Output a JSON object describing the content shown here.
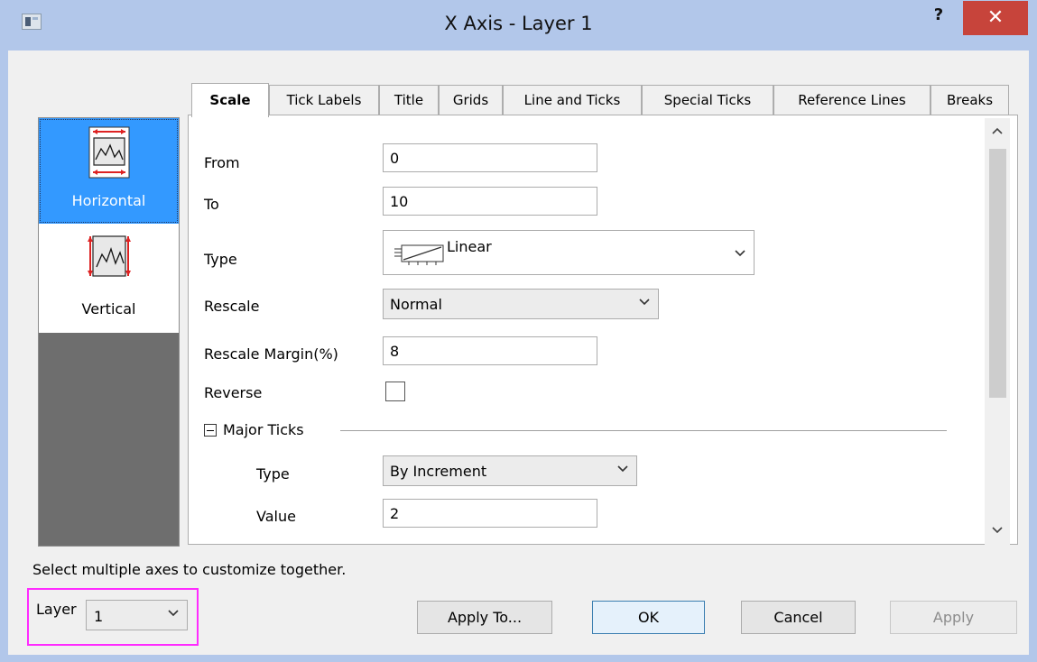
{
  "window": {
    "title": "X Axis - Layer 1",
    "help_label": "?",
    "close_label": "✕"
  },
  "sidebar": {
    "items": [
      {
        "label": "Horizontal",
        "selected": true
      },
      {
        "label": "Vertical",
        "selected": false
      }
    ]
  },
  "tabs": [
    {
      "label": "Scale",
      "active": true
    },
    {
      "label": "Tick Labels"
    },
    {
      "label": "Title"
    },
    {
      "label": "Grids"
    },
    {
      "label": "Line and Ticks"
    },
    {
      "label": "Special Ticks"
    },
    {
      "label": "Reference Lines"
    },
    {
      "label": "Breaks"
    }
  ],
  "scale": {
    "from_label": "From",
    "from_value": "0",
    "to_label": "To",
    "to_value": "10",
    "type_label": "Type",
    "type_value": "Linear",
    "rescale_label": "Rescale",
    "rescale_value": "Normal",
    "rescale_margin_label": "Rescale Margin(%)",
    "rescale_margin_value": "8",
    "reverse_label": "Reverse",
    "reverse_checked": false,
    "major_ticks": {
      "group_label": "Major Ticks",
      "type_label": "Type",
      "type_value": "By Increment",
      "value_label": "Value",
      "value_value": "2"
    }
  },
  "footer": {
    "hint": "Select multiple axes to customize together.",
    "layer_label": "Layer",
    "layer_value": "1",
    "apply_to_label": "Apply To...",
    "ok_label": "OK",
    "cancel_label": "Cancel",
    "apply_label": "Apply"
  },
  "colors": {
    "titlebar": "#b2c7ea",
    "close_button": "#c7443b",
    "selection": "#3399ff",
    "highlight_frame": "#ff2bff"
  }
}
